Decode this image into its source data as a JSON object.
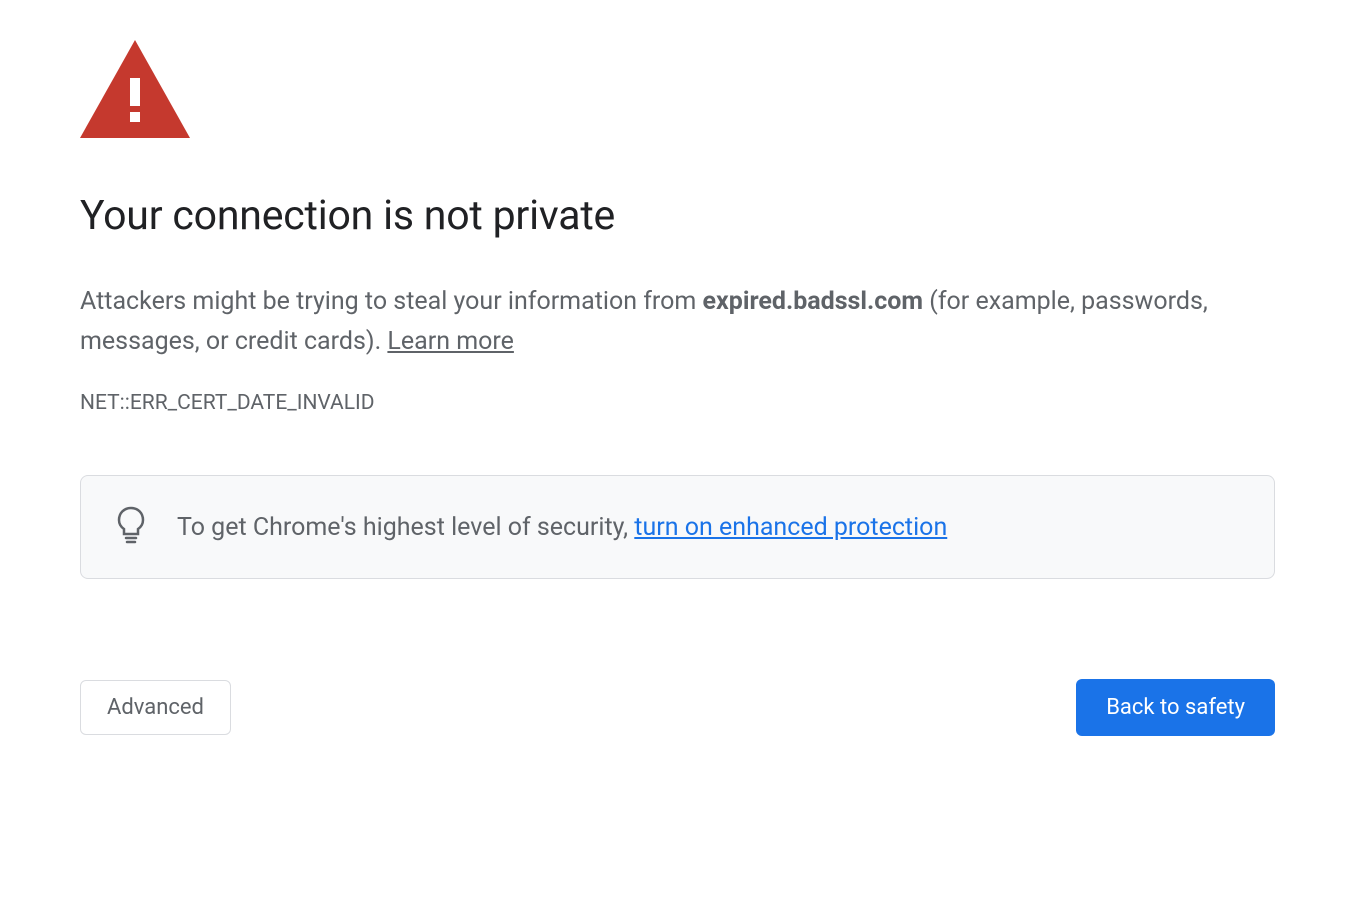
{
  "warning": {
    "heading": "Your connection is not private",
    "description_pre": "Attackers might be trying to steal your information from ",
    "domain": "expired.badssl.com",
    "description_post": " (for example, passwords, messages, or credit cards). ",
    "learn_more": "Learn more",
    "error_code": "NET::ERR_CERT_DATE_INVALID"
  },
  "info_box": {
    "text_pre": "To get Chrome's highest level of security, ",
    "link_text": "turn on enhanced protection"
  },
  "buttons": {
    "advanced": "Advanced",
    "back_to_safety": "Back to safety"
  },
  "colors": {
    "warning_red": "#c5392e",
    "primary_blue": "#1a73e8",
    "text_gray": "#5f6368",
    "border_gray": "#dadce0",
    "bg_light": "#f8f9fa"
  }
}
